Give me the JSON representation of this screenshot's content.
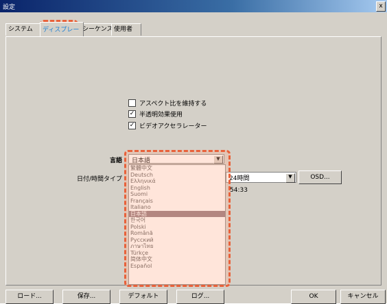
{
  "window": {
    "title": "設定",
    "close": "x"
  },
  "tabs": [
    {
      "label": "システム"
    },
    {
      "label": "ディスプレー"
    },
    {
      "label": "シーケンス"
    },
    {
      "label": "使用者"
    }
  ],
  "options": [
    {
      "label": "アスペクト比を維持する",
      "checked": false,
      "mark": ""
    },
    {
      "label": "半透明効果使用",
      "checked": true,
      "mark": "✓"
    },
    {
      "label": "ビデオアクセラレーター",
      "checked": true,
      "mark": "✓"
    }
  ],
  "language": {
    "label": "言語",
    "value": "日本語",
    "options": [
      "繁體中文",
      "Deutsch",
      "Ελληνικά",
      "English",
      "Suomi",
      "Français",
      "Italiano",
      "日本語",
      "한국어",
      "Polski",
      "Română",
      "Русский",
      "ภาษาไทย",
      "Türkçe",
      "简体中文",
      "Español"
    ],
    "selected_index": 7
  },
  "datetime": {
    "label": "日付/時間タイプ",
    "format_value": "24時間",
    "osd_button": "OSD...",
    "time_display": "54:33"
  },
  "footer": {
    "load": "ロード...",
    "save": "保存...",
    "default": "デフォルト",
    "log": "ログ...",
    "ok": "OK",
    "cancel": "キャンセル"
  },
  "colors": {
    "highlight": "#e8613a",
    "selected_item": "#8a6e76"
  }
}
